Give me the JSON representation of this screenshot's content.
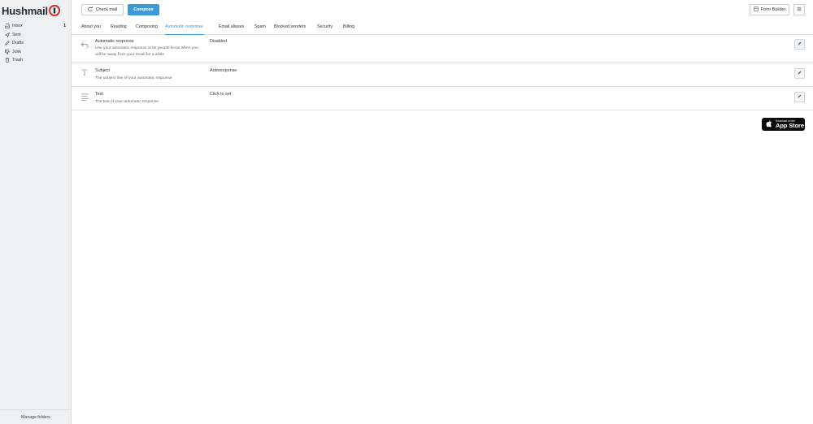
{
  "brand": {
    "name": "Hushmail"
  },
  "sidebar": {
    "folders": [
      {
        "label": "Inbox",
        "count": "1"
      },
      {
        "label": "Sent"
      },
      {
        "label": "Drafts"
      },
      {
        "label": "Junk"
      },
      {
        "label": "Trash"
      }
    ],
    "footer": "Manage folders"
  },
  "toolbar": {
    "check_mail": "Check mail",
    "compose": "Compose",
    "form_builder": "Form Builder"
  },
  "tabs": [
    "About you",
    "Reading",
    "Composing",
    "Automatic response",
    "Email aliases",
    "Spam",
    "Blocked senders",
    "Security",
    "Billing"
  ],
  "active_tab": "Automatic response",
  "settings": [
    {
      "title": "Automatic response",
      "description": "Use your automatic response to let people know when you will be away from your email for a while",
      "value": "Disabled",
      "icon": "reply-arrows-icon"
    },
    {
      "title": "Subject",
      "description": "The subject line of your automatic response",
      "value": "Autoresponse",
      "icon": "text-t-icon"
    },
    {
      "title": "Text",
      "description": "The text of your automatic response",
      "value": "Click to set",
      "icon": "text-lines-icon"
    }
  ],
  "app_store": {
    "small": "Download on the",
    "big": "App Store"
  },
  "colors": {
    "accent": "#3a9ad9",
    "sidebar_bg": "#eef0f1",
    "brand_red": "#d0312d"
  }
}
